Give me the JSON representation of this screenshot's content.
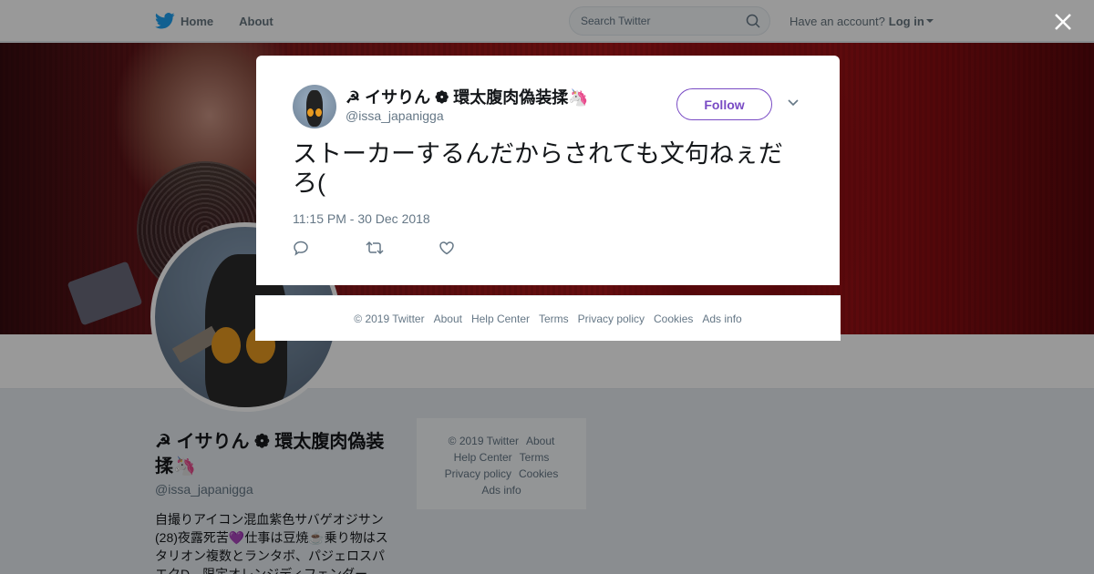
{
  "nav": {
    "home_label": "Home",
    "about_label": "About",
    "search_placeholder": "Search Twitter",
    "account_prompt": "Have an account?",
    "login_label": "Log in"
  },
  "profile": {
    "name": "☭ イサりん ❁ 環太腹肉偽装揉🦄",
    "handle": "@issa_japanigga",
    "bio": "自撮りアイコン混血紫色サバゲオジサン(28)夜露死苦💜仕事は豆焼☕乗り物はスタリオン複数とランタボ、パジェロスパエクD、限定オレンジディフェンダー"
  },
  "side_footer": {
    "copyright": "© 2019 Twitter",
    "about": "About",
    "help_center": "Help Center",
    "terms": "Terms",
    "privacy": "Privacy policy",
    "cookies": "Cookies",
    "ads_info": "Ads info"
  },
  "tweet": {
    "author_name": "☭ イサりん ❁ 環太腹肉偽装揉🦄",
    "author_handle": "@issa_japanigga",
    "follow_label": "Follow",
    "text": "ストーカーするんだからされても文句ねぇだろ(",
    "timestamp": "11:15 PM - 30 Dec 2018",
    "accent_color": "#794bc4"
  },
  "modal_footer": {
    "copyright": "© 2019 Twitter",
    "about": "About",
    "help_center": "Help Center",
    "terms": "Terms",
    "privacy": "Privacy policy",
    "cookies": "Cookies",
    "ads_info": "Ads info"
  },
  "icons": [
    "twitter-bird-icon",
    "search-icon",
    "close-icon",
    "chevron-down-icon",
    "reply-icon",
    "retweet-icon",
    "like-icon"
  ]
}
